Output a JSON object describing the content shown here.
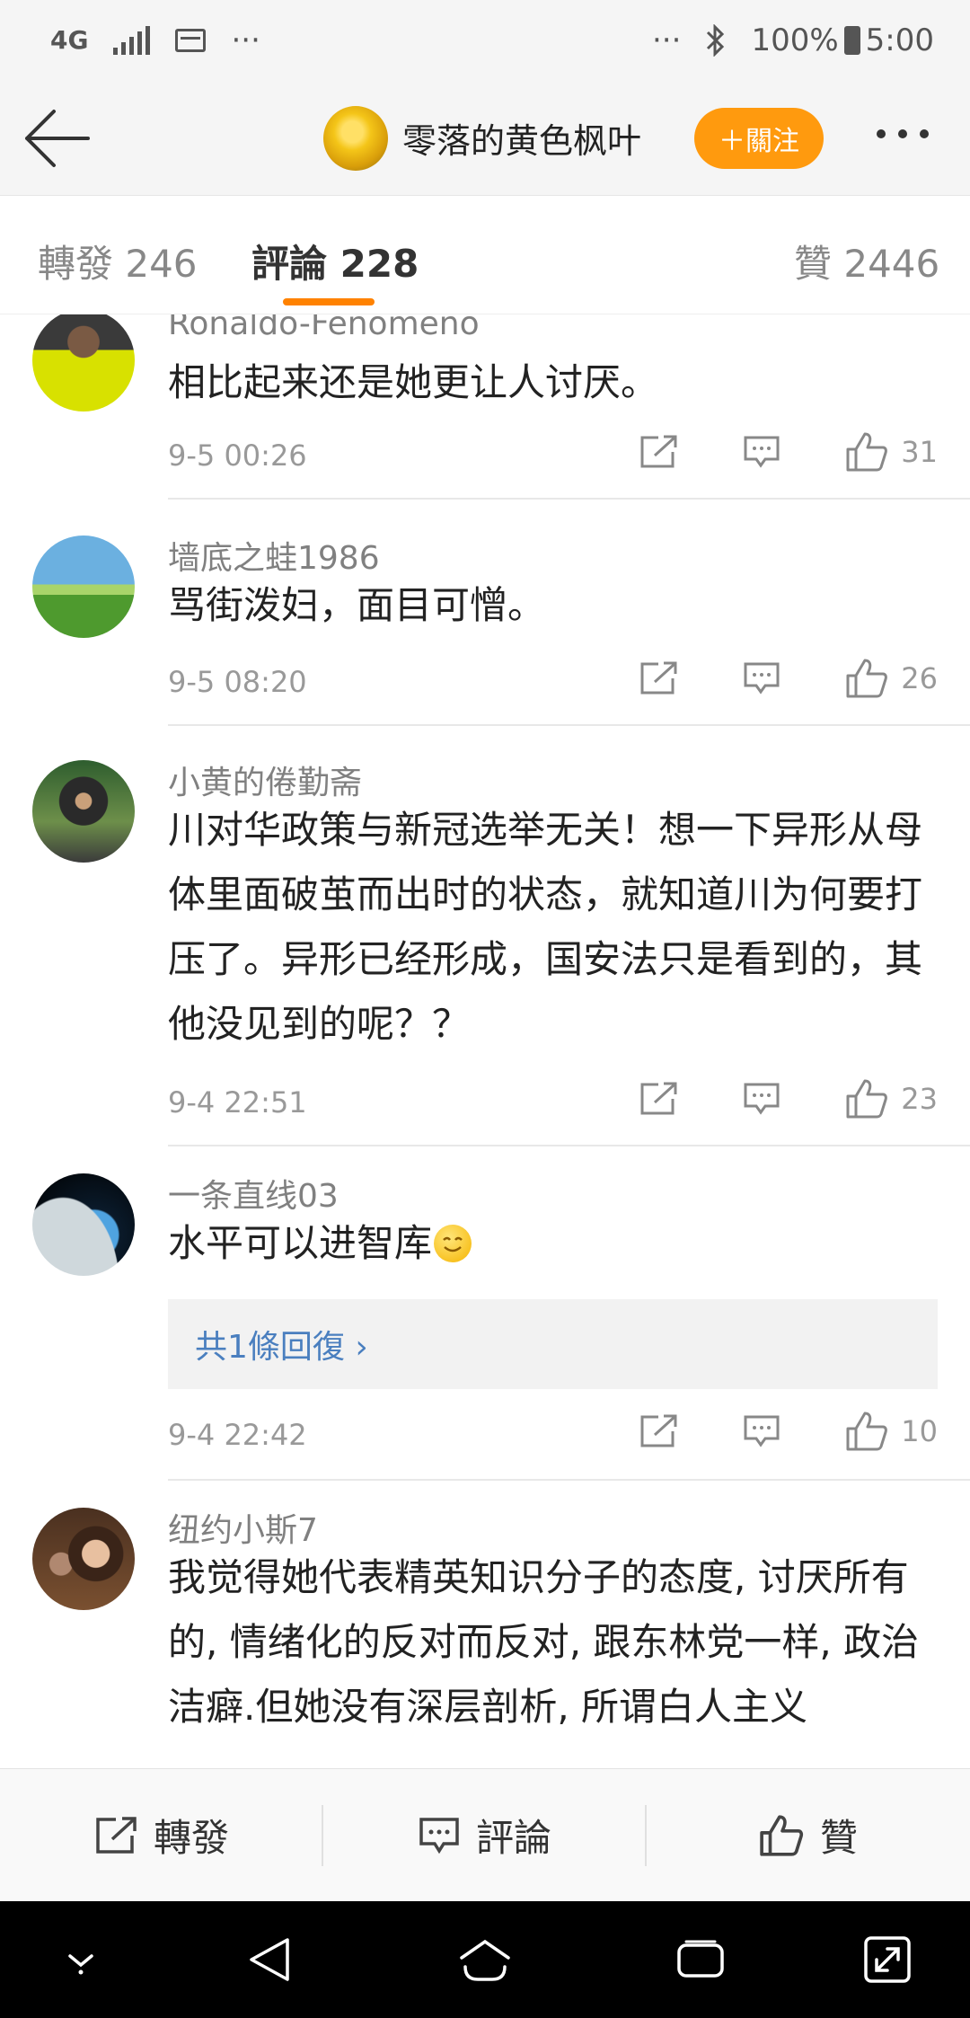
{
  "status_bar": {
    "network": "4G",
    "more": "···",
    "right_more": "···",
    "battery": "100%",
    "time": "5:00"
  },
  "header": {
    "title": "零落的黄色枫叶",
    "follow_label": "＋關注",
    "icons": [
      "back-arrow-icon",
      "more-icon"
    ]
  },
  "tabs": [
    {
      "label": "轉發 246"
    },
    {
      "label": "評論 228"
    },
    {
      "label": "贊 2446"
    }
  ],
  "comments": [
    {
      "user": "Ronaldo-Fenomeno",
      "text": "相比起来还是她更让人讨厌。",
      "time": "9-5 00:26",
      "likes": "31"
    },
    {
      "user": "墙底之蛙1986",
      "text": "骂街泼妇，面目可憎。",
      "time": "9-5 08:20",
      "likes": "26"
    },
    {
      "user": "小黄的倦勤斋",
      "text": "川对华政策与新冠选举无关！想一下异形从母体里面破茧而出时的状态，就知道川为何要打压了。异形已经形成，国安法只是看到的，其他没见到的呢？？",
      "time": "9-4 22:51",
      "likes": "23"
    },
    {
      "user": "一条直线03",
      "text": "水平可以进智库",
      "emoji": "smile-emoji-icon",
      "reply_label": "共1條回復 ›",
      "time": "9-4 22:42",
      "likes": "10"
    },
    {
      "user": "纽约小斯7",
      "text": "我觉得她代表精英知识分子的态度, 讨厌所有的, 情绪化的反对而反对, 跟东林党一样, 政治洁癖.但她没有深层剖析, 所谓白人主义"
    }
  ],
  "bottom_bar": {
    "repost_label": "轉發",
    "comment_label": "評論",
    "like_label": "贊"
  },
  "colors": {
    "accent_orange": "#ff8200",
    "follow_button": "#ff9a0e",
    "link_blue": "#4a7fbf"
  }
}
